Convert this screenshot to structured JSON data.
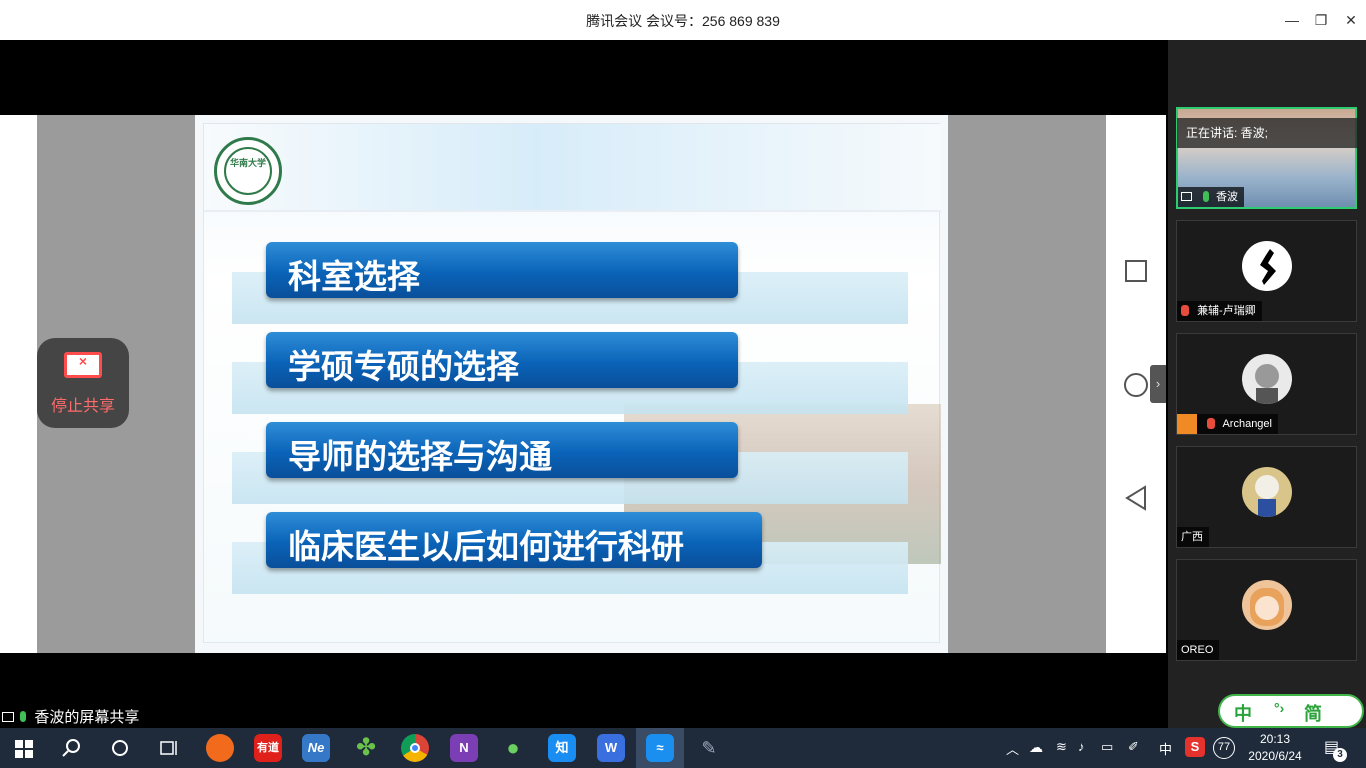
{
  "window": {
    "title": "腾讯会议 会议号：256 869 839",
    "minimize": "—",
    "restore": "❐",
    "close": "✕"
  },
  "slide": {
    "logo_text": "华南大学",
    "items": [
      "科室选择",
      "学硕专硕的选择",
      "导师的选择与沟通",
      "临床医生以后如何进行科研"
    ]
  },
  "controls": {
    "stop_share_label": "停止共享",
    "collapse_label": "›"
  },
  "sharer_label": "香波的屏幕共享",
  "speaking": "正在讲话: 香波;",
  "participants": [
    {
      "name": "香波"
    },
    {
      "name": "兼辅-卢瑞卿"
    },
    {
      "name": "Archangel"
    },
    {
      "name": "广西"
    },
    {
      "name": "OREO"
    }
  ],
  "ime": {
    "lang": "中",
    "mode": "简"
  },
  "taskbar": {
    "apps": [
      "youdao",
      "Ne",
      "clover",
      "chrome",
      "onenote",
      "wechat",
      "知",
      "wps",
      "tencent-meeting",
      "pen"
    ],
    "youdao_label": "有道",
    "ne_label": "Ne",
    "zhi_label": "知",
    "tray_lang": "中",
    "battery": "77",
    "time": "20:13",
    "date": "2020/6/24",
    "notifications": "3"
  }
}
